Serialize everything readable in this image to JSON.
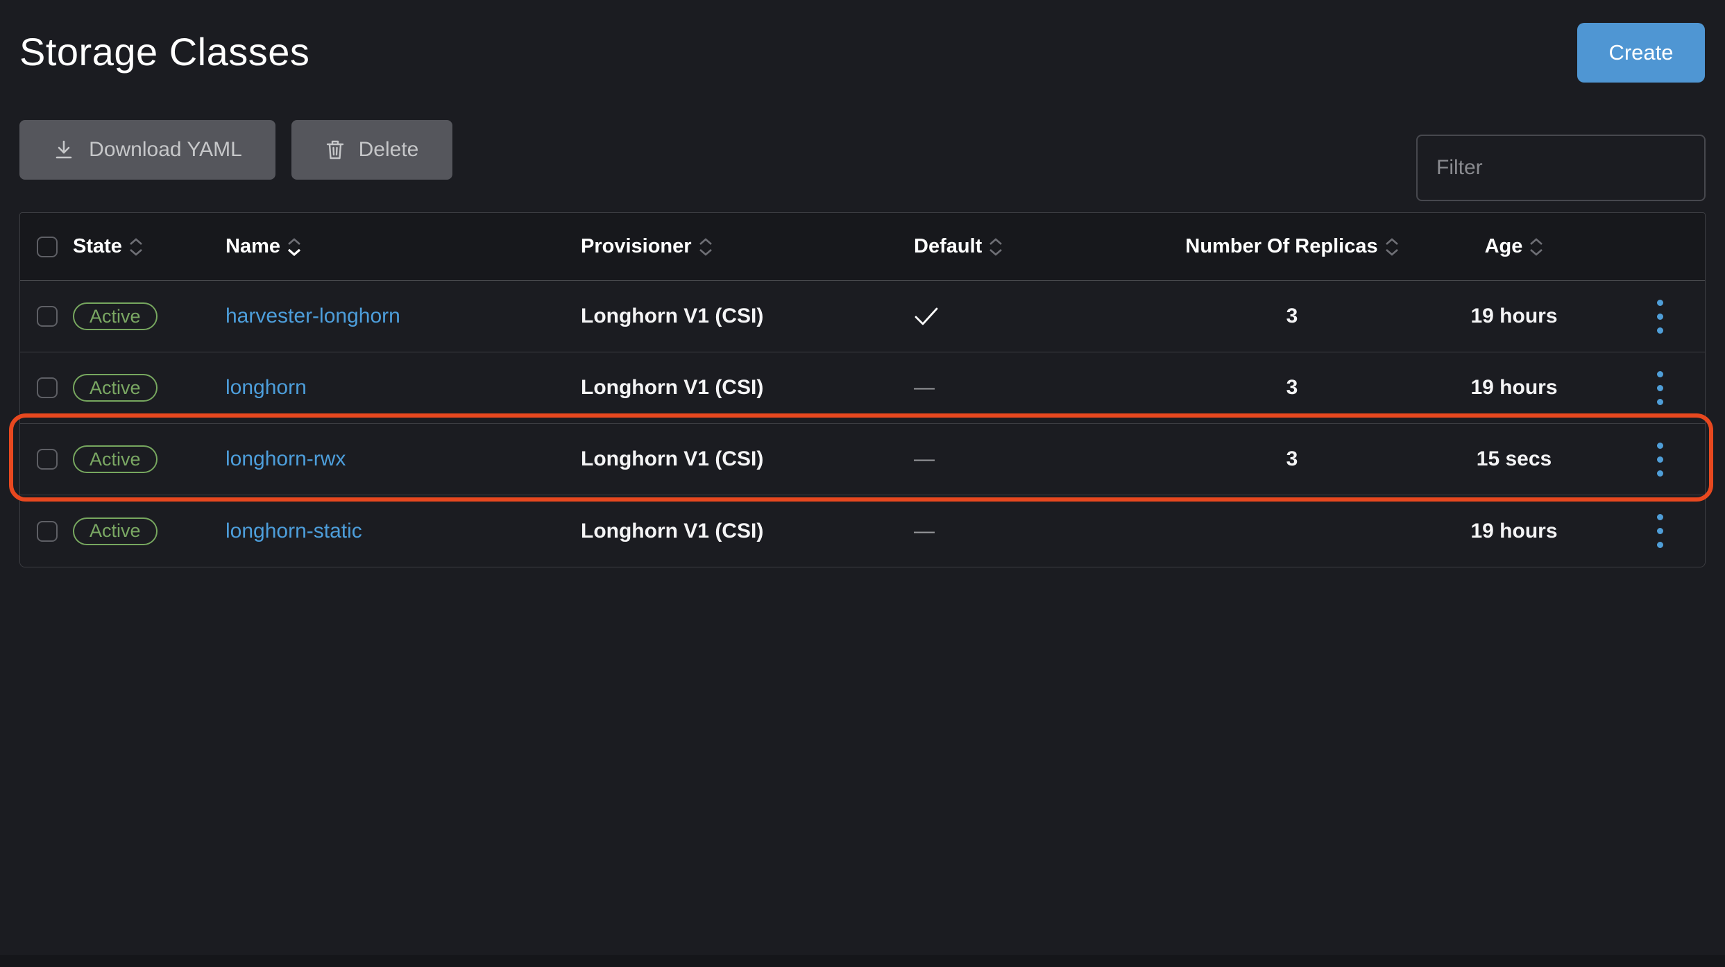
{
  "page": {
    "title": "Storage Classes"
  },
  "header": {
    "create_label": "Create"
  },
  "toolbar": {
    "download_label": "Download YAML",
    "delete_label": "Delete",
    "filter_placeholder": "Filter"
  },
  "table": {
    "columns": [
      {
        "label": "State",
        "sort": "none"
      },
      {
        "label": "Name",
        "sort": "active-desc"
      },
      {
        "label": "Provisioner",
        "sort": "none"
      },
      {
        "label": "Default",
        "sort": "none"
      },
      {
        "label": "Number Of Replicas",
        "sort": "none"
      },
      {
        "label": "Age",
        "sort": "none"
      }
    ],
    "rows": [
      {
        "state": "Active",
        "name": "harvester-longhorn",
        "provisioner": "Longhorn V1 (CSI)",
        "default": "✓",
        "replicas": "3",
        "age": "19 hours",
        "highlighted": false
      },
      {
        "state": "Active",
        "name": "longhorn",
        "provisioner": "Longhorn V1 (CSI)",
        "default": "—",
        "replicas": "3",
        "age": "19 hours",
        "highlighted": false
      },
      {
        "state": "Active",
        "name": "longhorn-rwx",
        "provisioner": "Longhorn V1 (CSI)",
        "default": "—",
        "replicas": "3",
        "age": "15 secs",
        "highlighted": true
      },
      {
        "state": "Active",
        "name": "longhorn-static",
        "provisioner": "Longhorn V1 (CSI)",
        "default": "—",
        "replicas": "",
        "age": "19 hours",
        "highlighted": false
      }
    ]
  },
  "annotation": {
    "target_row": "longhorn-rwx",
    "color": "#e8481f"
  },
  "colors": {
    "page_background": "#1b1c21",
    "table_header_background": "#17181c",
    "primary_button_blue": "#4f96d3",
    "disabled_button_gray": "#55565c",
    "link_blue": "#4d9edb",
    "badge_green": "#77a75f",
    "action_dots_blue": "#4f9ed8",
    "annotation_red": "#e8481f"
  },
  "icons": {
    "download-icon": "↓",
    "trash-icon": "🗑",
    "check-icon": "✓",
    "sort-chevrons-icon": "⌃⌄",
    "kebab-menu-icon": "⋮"
  }
}
